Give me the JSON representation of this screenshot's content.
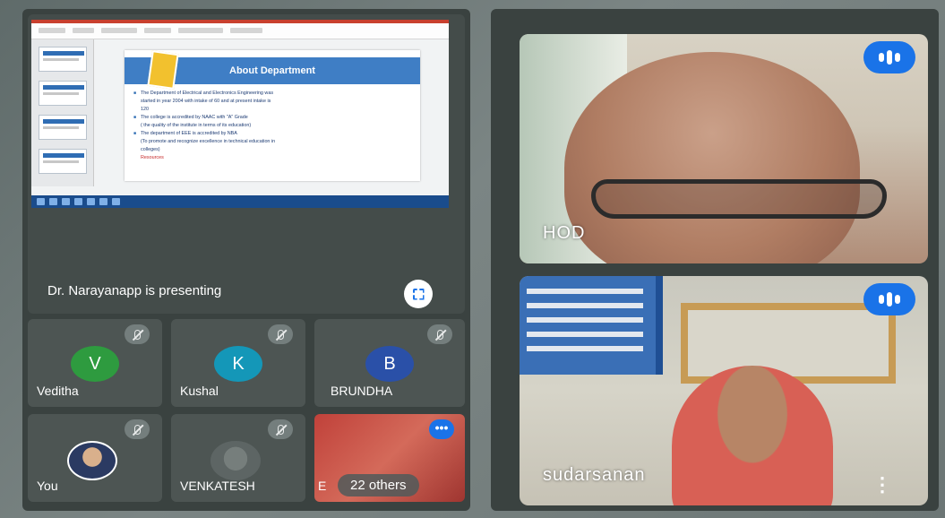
{
  "presentation": {
    "slide_title": "About Department",
    "slide_lines": [
      "The Department of Electrical and Electronics Engineering was",
      "started in year 2004 with intake of 60 and at present intake is",
      "120",
      "The college is accredited by NAAC with \"A\" Grade",
      "( the quality of the institute in terms of its education)",
      "The department of EEE is accredited by NBA",
      "(To promote and recognize excellence in technical education in",
      "colleges)",
      "Resources"
    ],
    "presenting_text": "Dr. Narayanapp is presenting"
  },
  "participants": [
    {
      "name": "Veditha",
      "initial": "V",
      "color": "#2e9b3f"
    },
    {
      "name": "Kushal",
      "initial": "K",
      "color": "#1497b8"
    },
    {
      "name": "BRUNDHA",
      "initial": "B",
      "color": "#2a50a8"
    },
    {
      "name": "You"
    },
    {
      "name": "VENKATESH"
    }
  ],
  "others": {
    "initial": "E",
    "label": "22 others"
  },
  "videos": [
    {
      "name": "HOD"
    },
    {
      "name": "sudarsanan",
      "more": "⋮"
    }
  ],
  "colors": {
    "accent": "#1a73e8"
  }
}
